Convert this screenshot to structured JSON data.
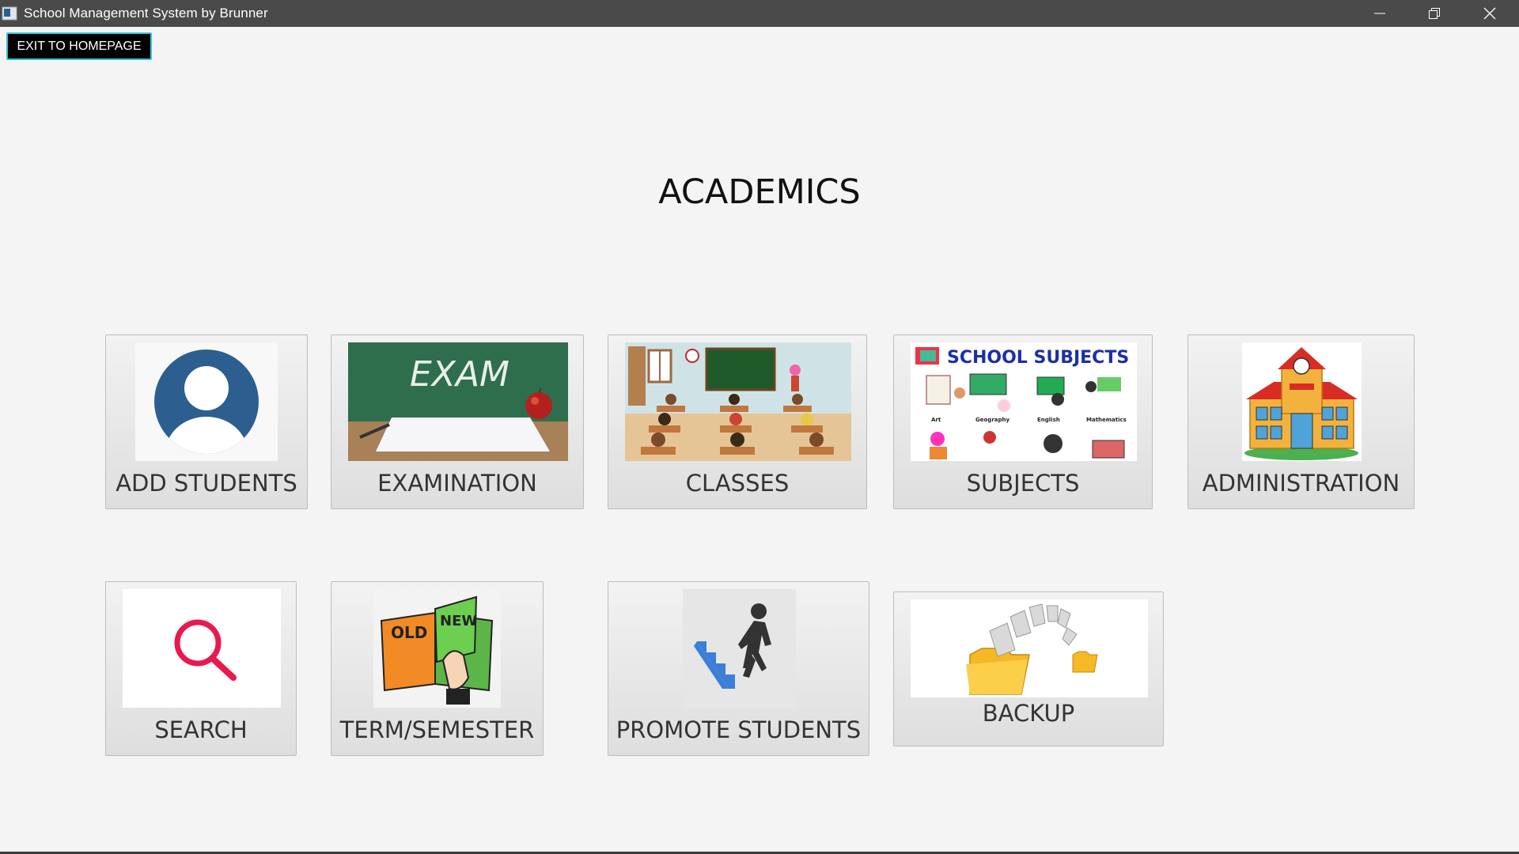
{
  "window": {
    "title": "School Management System by Brunner",
    "controls": [
      "minimize-icon",
      "restore-icon",
      "close-icon"
    ]
  },
  "toolbar": {
    "exit_label": "EXIT TO HOMEPAGE"
  },
  "page": {
    "title": "ACADEMICS"
  },
  "tiles": [
    {
      "label": "ADD STUDENTS",
      "icon": "user-avatar-icon"
    },
    {
      "label": "EXAMINATION",
      "icon": "exam-chalkboard-icon"
    },
    {
      "label": "CLASSES",
      "icon": "classroom-icon"
    },
    {
      "label": "SUBJECTS",
      "icon": "school-subjects-icon",
      "image_text": "SCHOOL SUBJECTS"
    },
    {
      "label": "ADMINISTRATION",
      "icon": "school-building-icon"
    },
    {
      "label": "SEARCH",
      "icon": "search-icon"
    },
    {
      "label": "TERM/SEMESTER",
      "icon": "old-new-book-icon",
      "image_text_old": "OLD",
      "image_text_new": "NEW"
    },
    {
      "label": "PROMOTE STUDENTS",
      "icon": "climbing-stairs-icon"
    },
    {
      "label": "BACKUP",
      "icon": "backup-folder-icon"
    }
  ],
  "colors": {
    "titlebar": "#4a4a4a",
    "background": "#f4f4f4",
    "exit_border": "#2ec8d8",
    "avatar_blue": "#2c5f8f",
    "search_red": "#e8194e"
  }
}
